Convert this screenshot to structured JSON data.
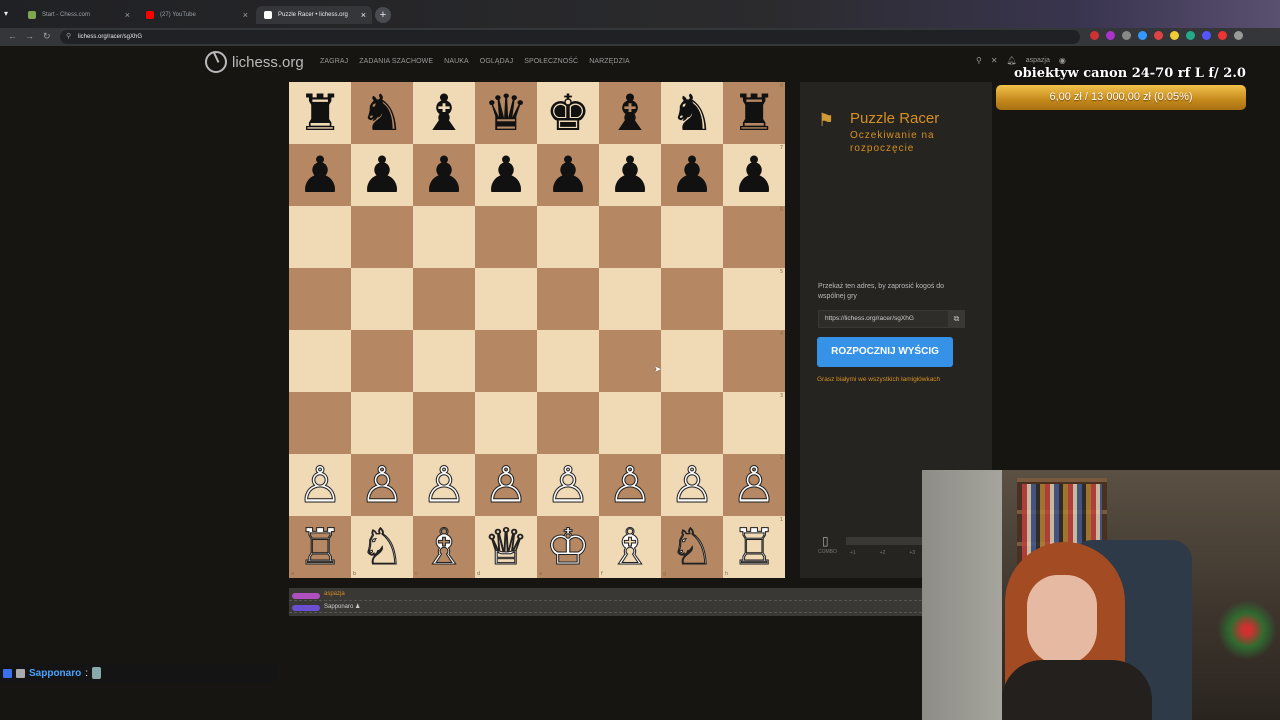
{
  "browser": {
    "tabs": [
      {
        "title": "Start - Chess.com",
        "favicon_color": "#7fa650"
      },
      {
        "title": "(27) YouTube",
        "favicon_color": "#ff0000"
      },
      {
        "title": "Puzzle Racer • lichess.org",
        "favicon_color": "#ffffff"
      }
    ],
    "address": "lichess.org/racer/sgXhG",
    "extension_colors": [
      "#c33",
      "#a3c",
      "#888",
      "#39f",
      "#d44",
      "#ec3",
      "#2a8",
      "#55f",
      "#e33",
      "#999"
    ]
  },
  "site": {
    "logo_text": "lichess.org",
    "nav": [
      "ZAGRAJ",
      "ZADANIA SZACHOWE",
      "NAUKA",
      "OGLĄDAJ",
      "SPOŁECZNOŚĆ",
      "NARZĘDZIA"
    ],
    "username": "aspazja"
  },
  "stream_overlay": {
    "goal_title": "obiektyw canon 24-70 rf L f/ 2.0",
    "goal_progress_text": "6,00 zł / 13 000,00 zł (0.05%)",
    "goal_progress": 0.0005
  },
  "board": {
    "ranks": [
      "8",
      "7",
      "6",
      "5",
      "4",
      "3",
      "2",
      "1"
    ],
    "files": [
      "a",
      "b",
      "c",
      "d",
      "e",
      "f",
      "g",
      "h"
    ],
    "position": [
      [
        "♜",
        "♞",
        "♝",
        "♛",
        "♚",
        "♝",
        "♞",
        "♜"
      ],
      [
        "♟",
        "♟",
        "♟",
        "♟",
        "♟",
        "♟",
        "♟",
        "♟"
      ],
      [
        "",
        "",
        "",
        "",
        "",
        "",
        "",
        ""
      ],
      [
        "",
        "",
        "",
        "",
        "",
        "",
        "",
        ""
      ],
      [
        "",
        "",
        "",
        "",
        "",
        "",
        "",
        ""
      ],
      [
        "",
        "",
        "",
        "",
        "",
        "",
        "",
        ""
      ],
      [
        "♙",
        "♙",
        "♙",
        "♙",
        "♙",
        "♙",
        "♙",
        "♙"
      ],
      [
        "♖",
        "♘",
        "♗",
        "♕",
        "♔",
        "♗",
        "♘",
        "♖"
      ]
    ]
  },
  "racer": {
    "title": "Puzzle Racer",
    "status": "Oczekiwanie na rozpoczęcie",
    "invite_label": "Przekaż ten adres, by zaprosić kogoś do wspólnej gry",
    "invite_url": "https://lichess.org/racer/sgXhG",
    "start_button": "ROZPOCZNIJ WYŚCIG",
    "white_note": "Grasz białymi we wszystkich łamigłówkach",
    "combo_label": "COMBO",
    "combo_ticks": [
      "+1",
      "+2",
      "+3"
    ]
  },
  "race_track": [
    {
      "name": "aspazja",
      "color": "#b050c0"
    },
    {
      "name": "Sapponaro ♟",
      "color": "#6a4fd0"
    }
  ],
  "chat": {
    "user": "Sapponaro",
    "separator": ":",
    "badge_colors": [
      "#3a6ff0",
      "#aaa"
    ]
  }
}
